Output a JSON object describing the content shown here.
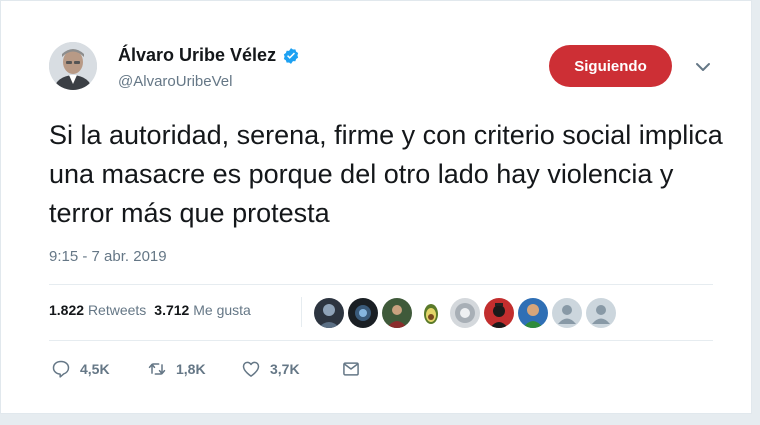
{
  "tweet": {
    "author": {
      "name": "Álvaro Uribe Vélez",
      "handle": "@AlvaroUribeVel",
      "verified": true
    },
    "follow_label": "Siguiendo",
    "text": "Si la autoridad, serena, firme y con criterio social implica una masacre es porque del otro lado hay violencia y terror más que protesta",
    "timestamp": "9:15 - 7 abr. 2019",
    "stats": {
      "retweets_count": "1.822",
      "retweets_label": "Retweets",
      "likes_count": "3.712",
      "likes_label": "Me gusta"
    },
    "actions": {
      "replies": "4,5K",
      "retweets": "1,8K",
      "likes": "3,7K"
    }
  },
  "colors": {
    "follow_button": "#cd2f35",
    "verified": "#1da1f2",
    "secondary_text": "#657786"
  },
  "icons": [
    "verified-badge-icon",
    "chevron-down-icon",
    "reply-icon",
    "retweet-icon",
    "like-icon",
    "direct-message-icon"
  ]
}
